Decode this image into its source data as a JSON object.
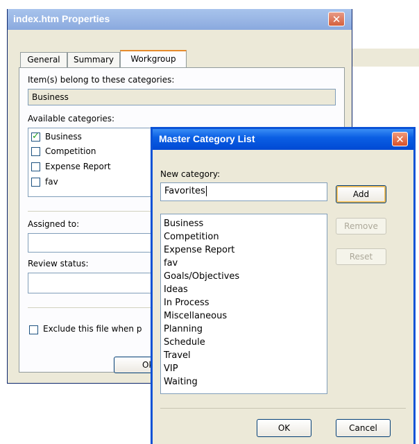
{
  "properties_window": {
    "title": "index.htm Properties",
    "close_glyph": "✕",
    "tabs": [
      {
        "label": "General",
        "active": false
      },
      {
        "label": "Summary",
        "active": false
      },
      {
        "label": "Workgroup",
        "active": true
      }
    ],
    "belong_label": "Item(s) belong to these categories:",
    "belong_value": "Business",
    "available_label": "Available categories:",
    "available_items": [
      {
        "label": "Business",
        "checked": true
      },
      {
        "label": "Competition",
        "checked": false
      },
      {
        "label": "Expense Report",
        "checked": false
      },
      {
        "label": "fav",
        "checked": false
      }
    ],
    "assigned_label": "Assigned to:",
    "assigned_value": "",
    "review_label": "Review status:",
    "review_value": "",
    "exclude_label": "Exclude this file when p",
    "ok_button_partial": "Ok"
  },
  "master_dialog": {
    "title": "Master Category List",
    "close_glyph": "✕",
    "new_category_label": "New category:",
    "new_category_value": "Favorites",
    "add_button": "Add",
    "remove_button": "Remove",
    "reset_button": "Reset",
    "categories": [
      "Business",
      "Competition",
      "Expense Report",
      "fav",
      "Goals/Objectives",
      "Ideas",
      "In Process",
      "Miscellaneous",
      "Planning",
      "Schedule",
      "Travel",
      "VIP",
      "Waiting"
    ],
    "ok_button": "OK",
    "cancel_button": "Cancel"
  },
  "colors": {
    "xp_blue": "#0a52d6",
    "close_red": "#d4603d",
    "tab_highlight": "#e68b2c",
    "dialog_face": "#ece9d8"
  }
}
